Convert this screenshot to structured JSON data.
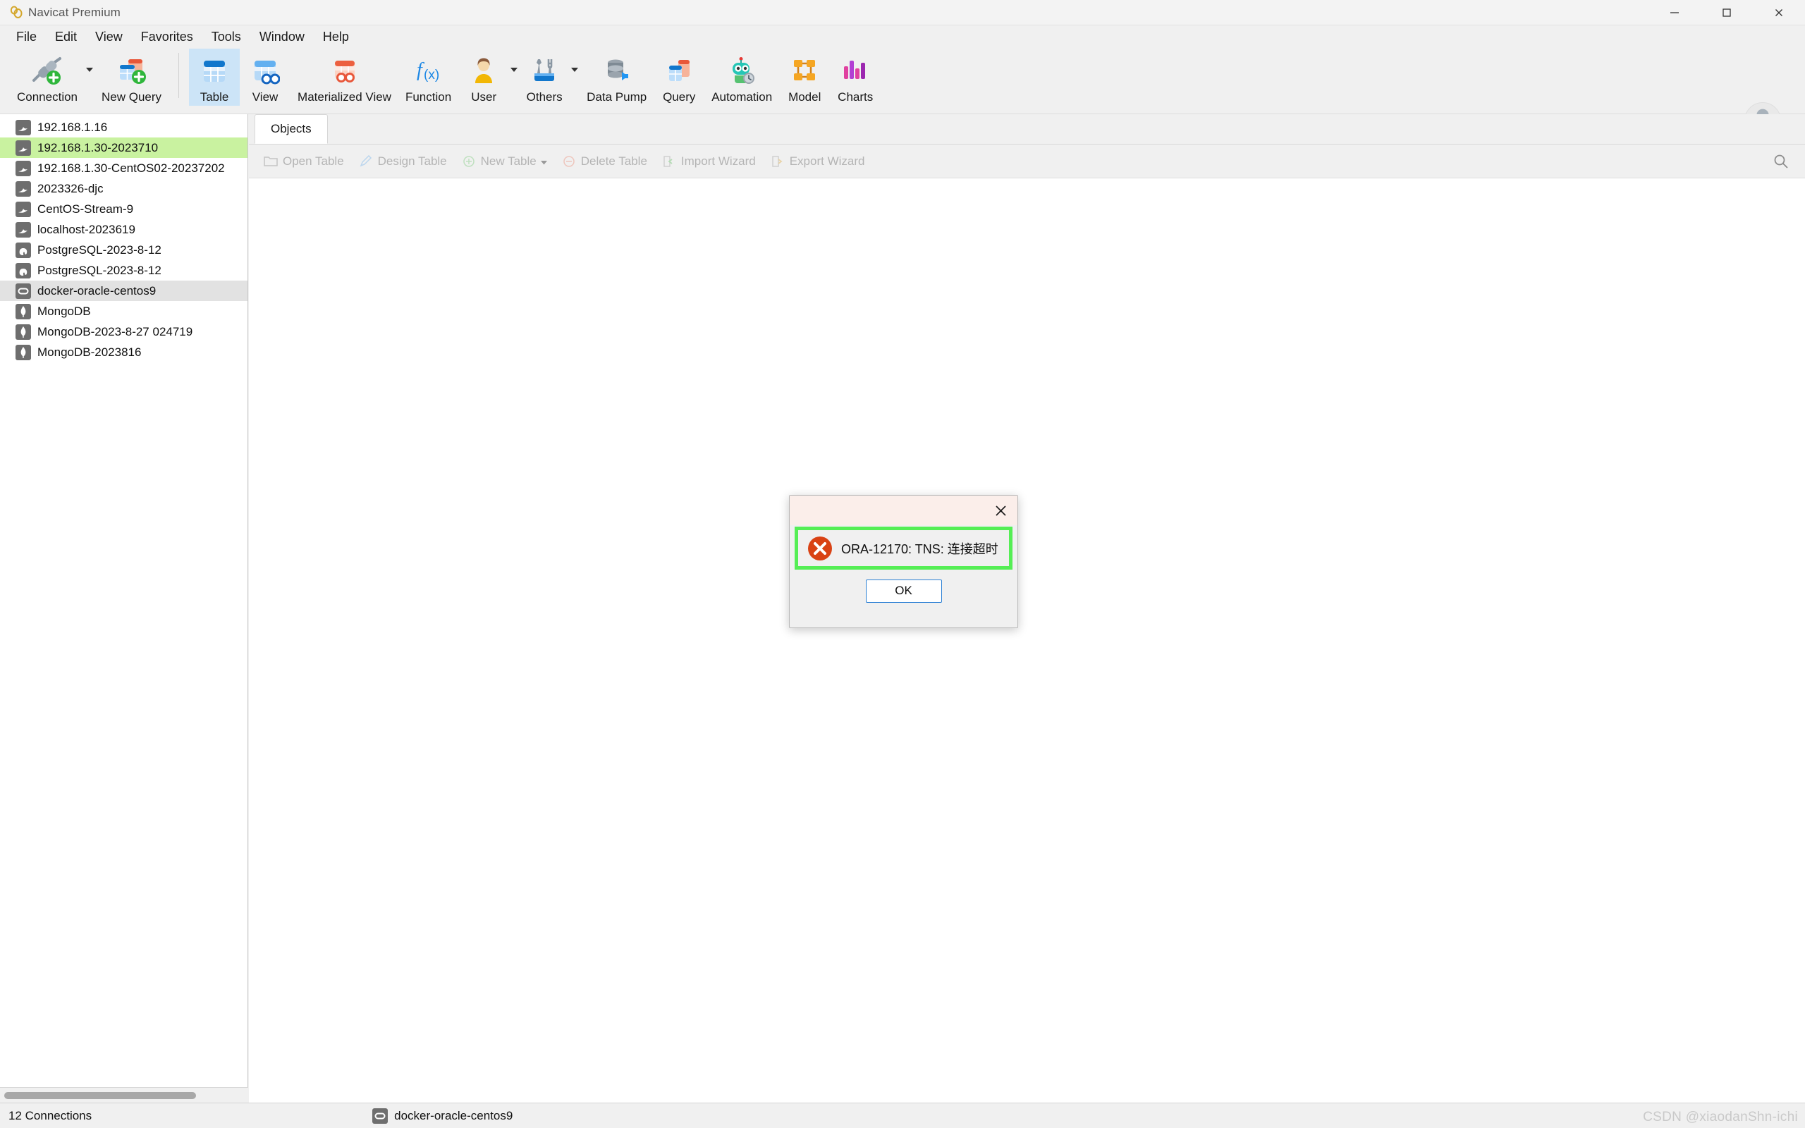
{
  "window": {
    "title": "Navicat Premium",
    "logo_icon": "navicat-logo-icon",
    "controls": [
      {
        "name": "minimize-button",
        "icon": "minimize-icon"
      },
      {
        "name": "maximize-button",
        "icon": "maximize-icon"
      },
      {
        "name": "close-button",
        "icon": "close-icon"
      }
    ]
  },
  "menubar": {
    "items": [
      {
        "label": "File"
      },
      {
        "label": "Edit"
      },
      {
        "label": "View"
      },
      {
        "label": "Favorites"
      },
      {
        "label": "Tools"
      },
      {
        "label": "Window"
      },
      {
        "label": "Help"
      }
    ]
  },
  "toolbar": {
    "items": [
      {
        "label": "Connection",
        "icon": "connection-plug-add-icon",
        "caret": true,
        "selected": false
      },
      {
        "label": "New Query",
        "icon": "new-query-add-icon",
        "caret": false,
        "selected": false
      },
      {
        "label": "Table",
        "icon": "table-icon",
        "caret": false,
        "selected": true
      },
      {
        "label": "View",
        "icon": "view-glasses-icon",
        "caret": false,
        "selected": false
      },
      {
        "label": "Materialized View",
        "icon": "materialized-view-icon",
        "caret": false,
        "selected": false
      },
      {
        "label": "Function",
        "icon": "function-fx-icon",
        "caret": false,
        "selected": false
      },
      {
        "label": "User",
        "icon": "user-icon",
        "caret": true,
        "selected": false
      },
      {
        "label": "Others",
        "icon": "others-tools-icon",
        "caret": true,
        "selected": false
      },
      {
        "label": "Data Pump",
        "icon": "data-pump-icon",
        "caret": false,
        "selected": false
      },
      {
        "label": "Query",
        "icon": "query-icon",
        "caret": false,
        "selected": false
      },
      {
        "label": "Automation",
        "icon": "automation-robot-icon",
        "caret": false,
        "selected": false
      },
      {
        "label": "Model",
        "icon": "model-diagram-icon",
        "caret": false,
        "selected": false
      },
      {
        "label": "Charts",
        "icon": "charts-bar-icon",
        "caret": false,
        "selected": false
      }
    ],
    "avatar_icon": "user-avatar-icon"
  },
  "sidebar": {
    "items": [
      {
        "label": "192.168.1.16",
        "icon": "mysql-dolphin-icon",
        "highlight": "none"
      },
      {
        "label": "192.168.1.30-2023710",
        "icon": "mysql-dolphin-icon",
        "highlight": "green"
      },
      {
        "label": "192.168.1.30-CentOS02-20237202",
        "icon": "mysql-dolphin-icon",
        "highlight": "none"
      },
      {
        "label": "2023326-djc",
        "icon": "mysql-dolphin-icon",
        "highlight": "none"
      },
      {
        "label": "CentOS-Stream-9",
        "icon": "mysql-dolphin-icon",
        "highlight": "none"
      },
      {
        "label": "localhost-2023619",
        "icon": "mysql-dolphin-icon",
        "highlight": "none"
      },
      {
        "label": "PostgreSQL-2023-8-12",
        "icon": "postgresql-elephant-icon",
        "highlight": "none"
      },
      {
        "label": "PostgreSQL-2023-8-12",
        "icon": "postgresql-elephant-icon",
        "highlight": "none"
      },
      {
        "label": "docker-oracle-centos9",
        "icon": "oracle-icon",
        "highlight": "gray"
      },
      {
        "label": "MongoDB",
        "icon": "mongodb-leaf-icon",
        "highlight": "none"
      },
      {
        "label": "MongoDB-2023-8-27 024719",
        "icon": "mongodb-leaf-icon",
        "highlight": "none"
      },
      {
        "label": "MongoDB-2023816",
        "icon": "mongodb-leaf-icon",
        "highlight": "none"
      }
    ],
    "scrollbar": "horizontal-scrollbar"
  },
  "content": {
    "tabs": [
      {
        "label": "Objects"
      }
    ],
    "object_toolbar": [
      {
        "label": "Open Table",
        "icon": "open-table-icon",
        "caret": false
      },
      {
        "label": "Design Table",
        "icon": "design-table-pencil-icon",
        "caret": false
      },
      {
        "label": "New Table",
        "icon": "new-table-plus-icon",
        "caret": true
      },
      {
        "label": "Delete Table",
        "icon": "delete-table-minus-icon",
        "caret": false
      },
      {
        "label": "Import Wizard",
        "icon": "import-wizard-icon",
        "caret": false
      },
      {
        "label": "Export Wizard",
        "icon": "export-wizard-icon",
        "caret": false
      }
    ],
    "search_icon": "search-icon"
  },
  "dialog": {
    "close_icon": "close-icon",
    "error_icon": "error-circle-icon",
    "message": "ORA-12170: TNS: 连接超时",
    "ok_label": "OK",
    "highlight_color": "#55ee55",
    "titlebar_color": "#fbeeea"
  },
  "statusbar": {
    "connections": "12 Connections",
    "database": "docker-oracle-centos9",
    "database_icon": "oracle-icon",
    "watermark": "CSDN @xiaodanShn-ichi"
  }
}
